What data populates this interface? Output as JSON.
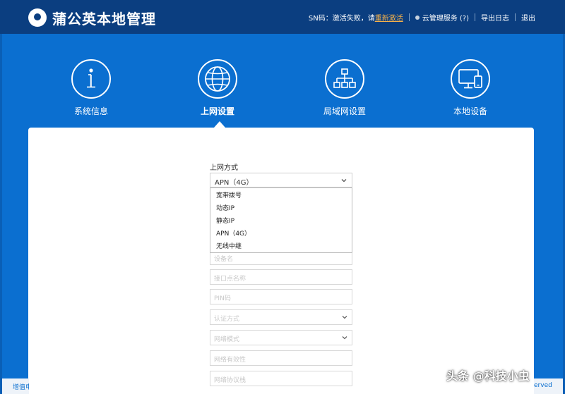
{
  "app": {
    "title": "蒲公英本地管理"
  },
  "header": {
    "sn_label": "SN码：激活失败，请",
    "sn_link": "重新激活",
    "cloud_label": "云管理服务 (?)",
    "export_log": "导出日志",
    "logout": "退出"
  },
  "nav": {
    "tabs": [
      {
        "label": "系统信息",
        "icon": "info-icon"
      },
      {
        "label": "上网设置",
        "icon": "globe-icon",
        "active": true
      },
      {
        "label": "局域网设置",
        "icon": "network-icon"
      },
      {
        "label": "本地设备",
        "icon": "devices-icon"
      }
    ]
  },
  "form": {
    "mode_label": "上网方式",
    "mode_value": "APN（4G）",
    "options": [
      "宽带拨号",
      "动态IP",
      "静态IP",
      "APN（4G）",
      "无线中继"
    ],
    "fields": [
      {
        "placeholder": "设备名"
      },
      {
        "placeholder": "接口点名称"
      },
      {
        "placeholder": "PIN码"
      },
      {
        "placeholder": "认证方式",
        "dropdown": true
      },
      {
        "placeholder": "网络模式",
        "dropdown": true
      },
      {
        "placeholder": "网络有效性"
      },
      {
        "placeholder": "网络协议栈"
      }
    ]
  },
  "footer": {
    "left_text": "增值电",
    "right_text": "erved"
  },
  "watermark": {
    "text": "头条 @科技小虫"
  },
  "colors": {
    "topbar": "#0b3e80",
    "background": "#0b6fd0",
    "accent_link": "#f5b14a",
    "panel": "#ffffff"
  }
}
